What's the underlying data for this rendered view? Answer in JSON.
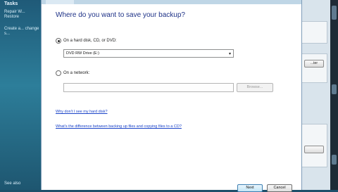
{
  "background": {
    "tasks_title": "Tasks",
    "tasks": [
      "Repair W... Restore",
      "Create a... change s..."
    ],
    "see_also": "See also",
    "right_buttons": [
      "",
      "...ter"
    ]
  },
  "wizard": {
    "heading": "Where do you want to save your backup?",
    "option_disk": {
      "label": "On a hard disk, CD, or DVD:",
      "selected": true,
      "dropdown_value": "DVD RW Drive (E:)"
    },
    "option_network": {
      "label": "On a network:",
      "selected": false,
      "path_value": "",
      "browse_label": "Browse..."
    },
    "link_why": "Why don't I see my hard disk?",
    "link_difference": "What's the difference between backing up files and copying files to a CD?",
    "next_label": "Next",
    "cancel_label": "Cancel"
  }
}
